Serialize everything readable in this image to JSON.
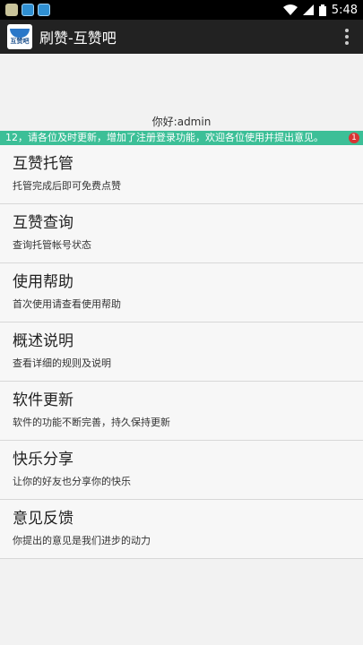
{
  "status_bar": {
    "time": "5:48"
  },
  "app_bar": {
    "title": "刷赞-互赞吧",
    "logo_text": "互赞吧"
  },
  "greeting": "你好:admin",
  "notice": {
    "text": "12，请各位及时更新，增加了注册登录功能，欢迎各位使用并提出意见。",
    "badge": "1"
  },
  "menu": [
    {
      "title": "互赞托管",
      "subtitle": "托管完成后即可免费点赞"
    },
    {
      "title": "互赞查询",
      "subtitle": "查询托管帐号状态"
    },
    {
      "title": "使用帮助",
      "subtitle": "首次使用请查看使用帮助"
    },
    {
      "title": "概述说明",
      "subtitle": "查看详细的规则及说明"
    },
    {
      "title": "软件更新",
      "subtitle": "软件的功能不断完善，持久保持更新"
    },
    {
      "title": "快乐分享",
      "subtitle": "让你的好友也分享你的快乐"
    },
    {
      "title": "意见反馈",
      "subtitle": "你提出的意见是我们进步的动力"
    }
  ]
}
